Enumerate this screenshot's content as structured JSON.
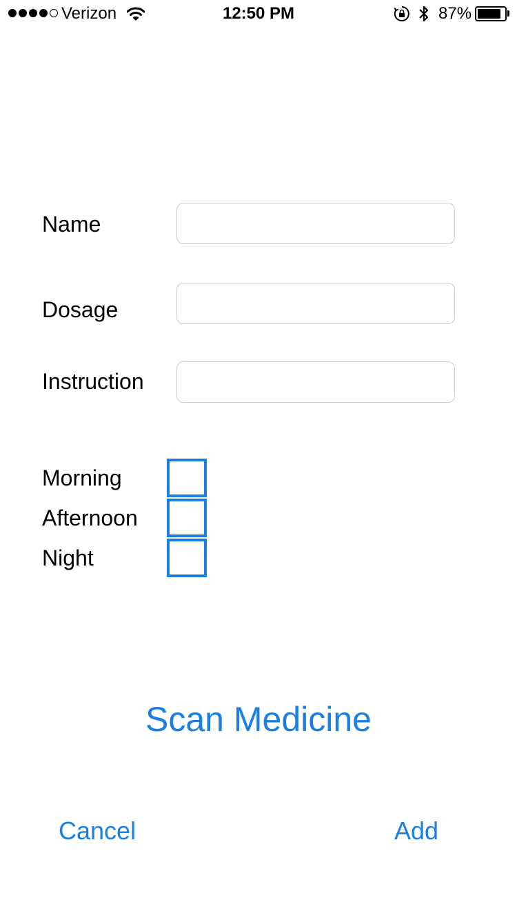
{
  "status_bar": {
    "signal_bars_filled": 4,
    "signal_bars_total": 5,
    "carrier": "Verizon",
    "time": "12:50 PM",
    "battery_percent_text": "87%",
    "battery_level": 0.87,
    "icons": [
      "wifi-icon",
      "orientation-lock-icon",
      "bluetooth-icon",
      "battery-icon"
    ]
  },
  "form": {
    "name_label": "Name",
    "name_value": "",
    "dosage_label": "Dosage",
    "dosage_value": "",
    "instruction_label": "Instruction",
    "instruction_value": "",
    "schedule": [
      {
        "label": "Morning",
        "checked": false
      },
      {
        "label": "Afternoon",
        "checked": false
      },
      {
        "label": "Night",
        "checked": false
      }
    ]
  },
  "actions": {
    "scan_label": "Scan Medicine",
    "cancel_label": "Cancel",
    "add_label": "Add"
  },
  "colors": {
    "accent": "#1a7fe0",
    "field_border": "#cdcdcd",
    "text": "#000000",
    "background": "#ffffff"
  }
}
